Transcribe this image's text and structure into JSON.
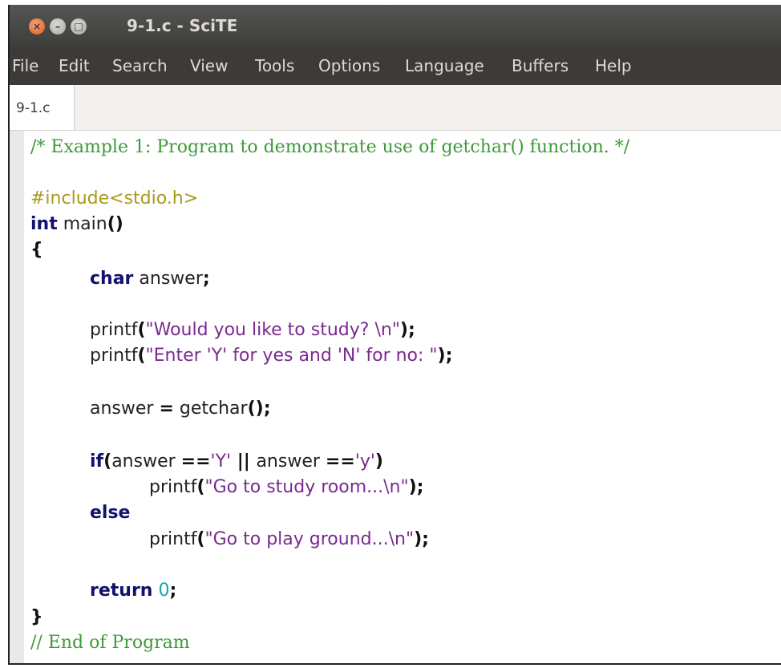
{
  "window": {
    "title": "9-1.c - SciTE",
    "controls": {
      "close": "×",
      "minimize": "–",
      "maximize": "□"
    }
  },
  "menubar": {
    "items": [
      "File",
      "Edit",
      "Search",
      "View",
      "Tools",
      "Options",
      "Language",
      "Buffers",
      "Help"
    ]
  },
  "tabs": [
    {
      "label": "9-1.c"
    }
  ],
  "code": {
    "comment_header": "/* Example 1: Program to demonstrate use of getchar() function. */",
    "include": "#include<stdio.h>",
    "kw_int": "int",
    "main_name": " main",
    "parens": "()",
    "open_brace": "{",
    "kw_char": "char",
    "answer_decl": " answer",
    "semi": ";",
    "printf": "printf",
    "lparen": "(",
    "rparen_semi": ");",
    "str_study": "\"Would you like to study? \\n\"",
    "str_enter": "\"Enter 'Y' for yes and 'N' for no: \"",
    "assign_lhs": "answer ",
    "eq": "=",
    "getchar_name": " getchar",
    "paren_semi": "();",
    "kw_if": "if",
    "answer": "answer ",
    "eqeq": "==",
    "char_Y": "'Y'",
    "oror": " || ",
    "char_y": "'y'",
    "rparen": ")",
    "str_study_room": "\"Go to study room...\\n\"",
    "kw_else": "else",
    "str_play": "\"Go to play ground...\\n\"",
    "kw_return": "return",
    "zero": " 0",
    "close_brace": "}",
    "comment_footer": "// End of Program"
  },
  "colors": {
    "comment": "#3f9a3a",
    "preprocessor": "#a99a1b",
    "keyword": "#11116e",
    "string": "#7a2a8e",
    "number": "#1aa5b3",
    "titlebar": "#4a4a48",
    "menubar": "#3c3b37",
    "close_button": "#e95f22"
  }
}
